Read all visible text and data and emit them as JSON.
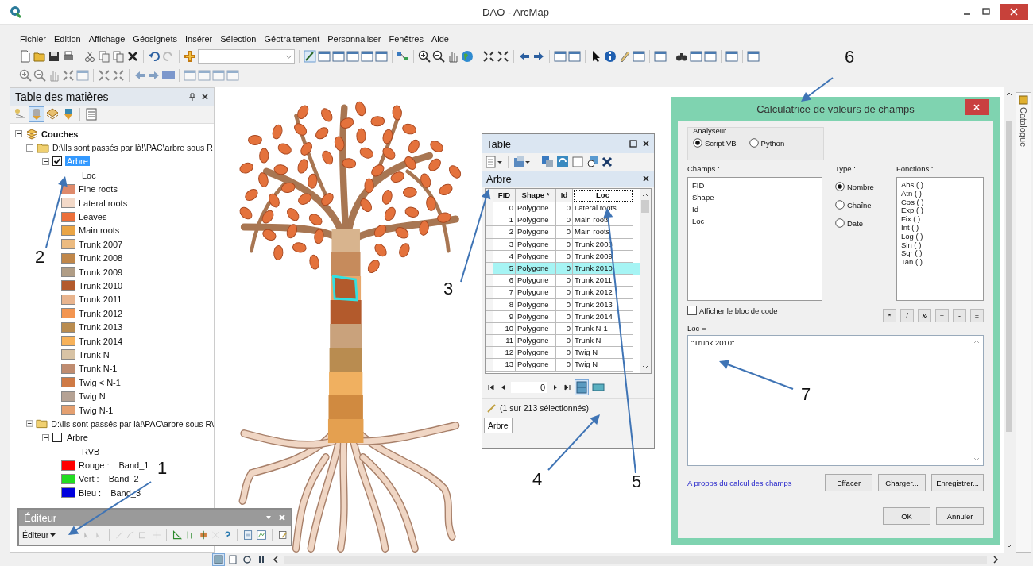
{
  "window": {
    "title": "DAO - ArcMap"
  },
  "menu": [
    "Fichier",
    "Edition",
    "Affichage",
    "Géosignets",
    "Insérer",
    "Sélection",
    "Géotraitement",
    "Personnaliser",
    "Fenêtres",
    "Aide"
  ],
  "toc": {
    "title": "Table des matières",
    "root": "Couches",
    "groups": [
      {
        "path": "D:\\Ils sont passés par là!\\PAC\\arbre sous R",
        "expanded": true,
        "layer": {
          "name": "Arbre",
          "checked": true,
          "selected": true,
          "field": "Loc",
          "classes": [
            {
              "label": "Fine roots",
              "color": "#df8a6b"
            },
            {
              "label": "Lateral roots",
              "color": "#f3d9c8"
            },
            {
              "label": "Leaves",
              "color": "#ec6f3a"
            },
            {
              "label": "Main roots",
              "color": "#eaa545"
            },
            {
              "label": "Trunk 2007",
              "color": "#ecbb80"
            },
            {
              "label": "Trunk 2008",
              "color": "#c0874a"
            },
            {
              "label": "Trunk 2009",
              "color": "#b09d86"
            },
            {
              "label": "Trunk 2010",
              "color": "#b35a2c"
            },
            {
              "label": "Trunk 2011",
              "color": "#e8b48e"
            },
            {
              "label": "Trunk 2012",
              "color": "#f39550"
            },
            {
              "label": "Trunk 2013",
              "color": "#b98c50"
            },
            {
              "label": "Trunk 2014",
              "color": "#f7b25a"
            },
            {
              "label": "Trunk N",
              "color": "#d8c3a5"
            },
            {
              "label": "Trunk N-1",
              "color": "#bf8c70"
            },
            {
              "label": "Twig < N-1",
              "color": "#cf7a45"
            },
            {
              "label": "Twig N",
              "color": "#b5a294"
            },
            {
              "label": "Twig N-1",
              "color": "#e4a070"
            }
          ]
        }
      },
      {
        "path": "D:\\Ils sont passés par là!\\PAC\\arbre sous R\\",
        "expanded": true,
        "layer": {
          "name": "Arbre",
          "checked": false,
          "selected": false,
          "field": "RVB",
          "classes": [
            {
              "label": "Rouge :",
              "value": "Band_1",
              "color": "#ff0000"
            },
            {
              "label": "Vert :",
              "value": "Band_2",
              "color": "#22dd22"
            },
            {
              "label": "Bleu :",
              "value": "Band_3",
              "color": "#0000dd"
            }
          ]
        }
      }
    ]
  },
  "editor": {
    "title": "Éditeur",
    "menu": "Éditeur"
  },
  "table": {
    "title": "Table",
    "layer": "Arbre",
    "columns": [
      "FID",
      "Shape *",
      "Id",
      "Loc"
    ],
    "rows": [
      {
        "cells": [
          "0",
          "Polygone",
          "0",
          "Lateral roots"
        ],
        "selected": false
      },
      {
        "cells": [
          "1",
          "Polygone",
          "0",
          "Main roots"
        ],
        "selected": false
      },
      {
        "cells": [
          "2",
          "Polygone",
          "0",
          "Main roots"
        ],
        "selected": false
      },
      {
        "cells": [
          "3",
          "Polygone",
          "0",
          "Trunk 2008"
        ],
        "selected": false
      },
      {
        "cells": [
          "4",
          "Polygone",
          "0",
          "Trunk 2009"
        ],
        "selected": false
      },
      {
        "cells": [
          "5",
          "Polygone",
          "0",
          "Trunk 2010"
        ],
        "selected": true
      },
      {
        "cells": [
          "6",
          "Polygone",
          "0",
          "Trunk 2011"
        ],
        "selected": false
      },
      {
        "cells": [
          "7",
          "Polygone",
          "0",
          "Trunk 2012"
        ],
        "selected": false
      },
      {
        "cells": [
          "8",
          "Polygone",
          "0",
          "Trunk 2013"
        ],
        "selected": false
      },
      {
        "cells": [
          "9",
          "Polygone",
          "0",
          "Trunk 2014"
        ],
        "selected": false
      },
      {
        "cells": [
          "10",
          "Polygone",
          "0",
          "Trunk N-1"
        ],
        "selected": false
      },
      {
        "cells": [
          "11",
          "Polygone",
          "0",
          "Trunk N"
        ],
        "selected": false
      },
      {
        "cells": [
          "12",
          "Polygone",
          "0",
          "Twig N"
        ],
        "selected": false
      },
      {
        "cells": [
          "13",
          "Polygone",
          "0",
          "Twig N"
        ],
        "selected": false
      }
    ],
    "record": "0",
    "status": "(1 sur 213 sélectionnés)",
    "tab": "Arbre"
  },
  "calculator": {
    "title": "Calculatrice de valeurs de champs",
    "parser_label": "Analyseur",
    "parsers": [
      {
        "label": "Script VB",
        "selected": true
      },
      {
        "label": "Python",
        "selected": false
      }
    ],
    "fields_label": "Champs :",
    "fields": [
      "FID",
      "Shape",
      "Id",
      "Loc"
    ],
    "type_label": "Type :",
    "types": [
      {
        "label": "Nombre",
        "selected": true
      },
      {
        "label": "Chaîne",
        "selected": false
      },
      {
        "label": "Date",
        "selected": false
      }
    ],
    "functions_label": "Fonctions :",
    "functions": [
      "Abs ( )",
      "Atn ( )",
      "Cos ( )",
      "Exp ( )",
      "Fix ( )",
      "Int ( )",
      "Log ( )",
      "Sin ( )",
      "Sqr ( )",
      "Tan ( )"
    ],
    "show_code": {
      "label": "Afficher le bloc de code",
      "checked": false
    },
    "operators": [
      "*",
      "/",
      "&",
      "+",
      "-",
      "="
    ],
    "expression_label": "Loc =",
    "expression": "\"Trunk 2010\"",
    "help_link": "A propos du calcul des champs",
    "buttons": [
      "Effacer",
      "Charger...",
      "Enregistrer..."
    ],
    "dialog_buttons": [
      "OK",
      "Annuler"
    ]
  },
  "catalog_tab": "Catalogue",
  "annotations": [
    "1",
    "2",
    "3",
    "4",
    "5",
    "6",
    "7"
  ]
}
